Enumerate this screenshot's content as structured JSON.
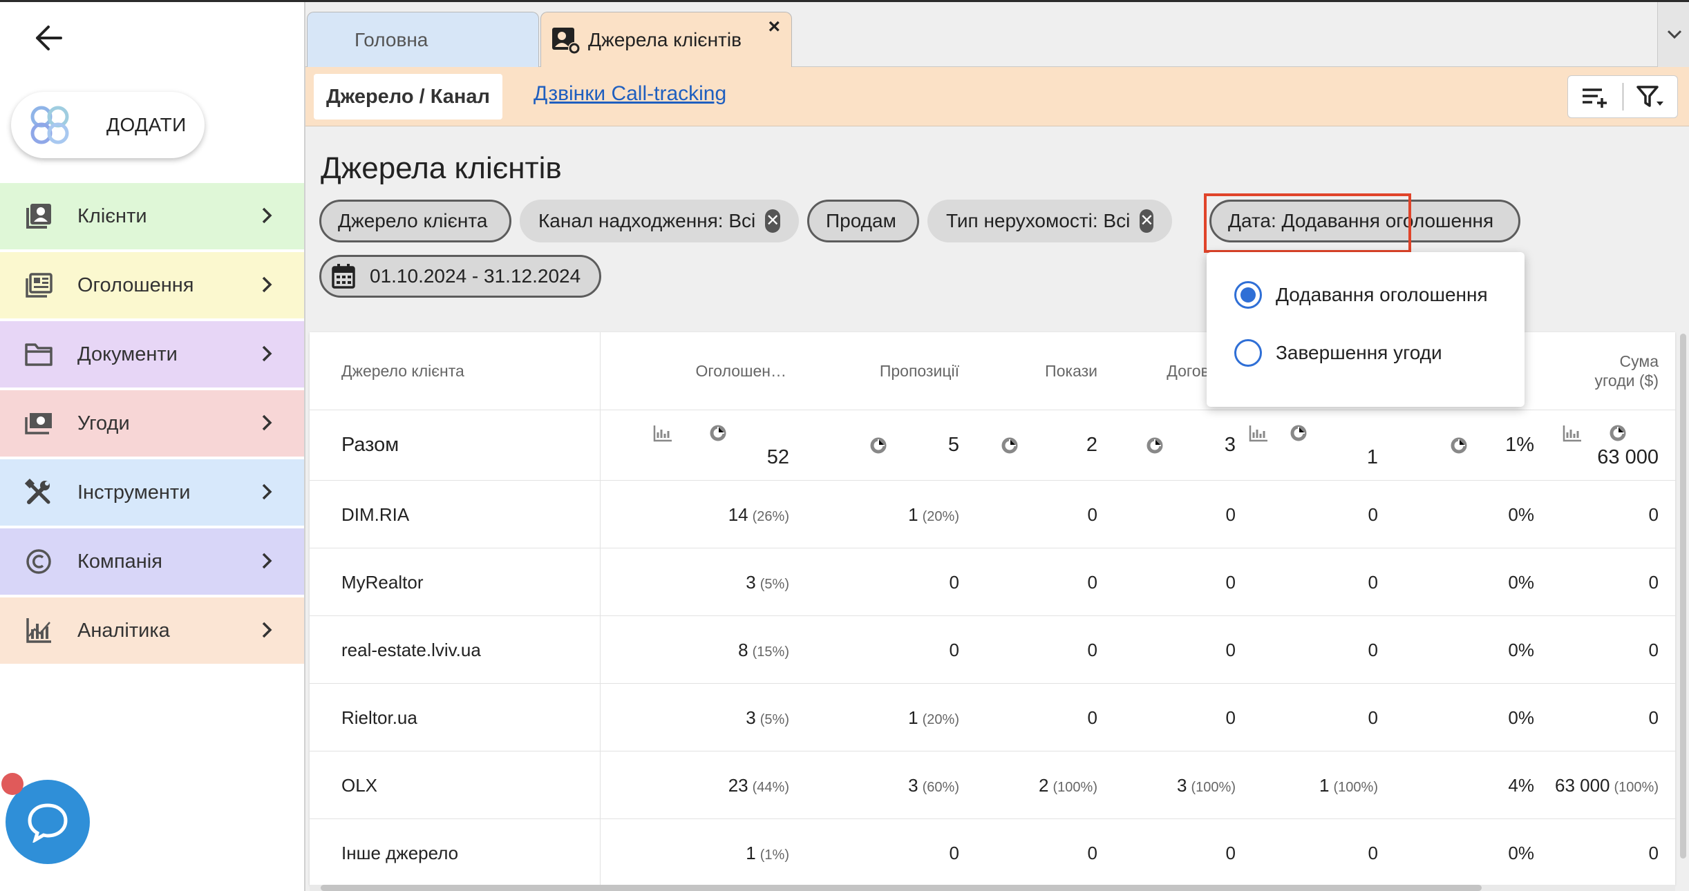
{
  "sidebar": {
    "add_label": "ДОДАТИ",
    "items": [
      {
        "label": "Клієнти",
        "bg": "#dff7d7"
      },
      {
        "label": "Оголошення",
        "bg": "#fbf8cf"
      },
      {
        "label": "Документи",
        "bg": "#e7d6f6"
      },
      {
        "label": "Угоди",
        "bg": "#f7d6d6"
      },
      {
        "label": "Інструменти",
        "bg": "#d7e8fb"
      },
      {
        "label": "Компанія",
        "bg": "#d8d6f8"
      },
      {
        "label": "Аналітика",
        "bg": "#fbe5d4"
      }
    ]
  },
  "tabs": {
    "home": "Головна",
    "sources": "Джерела клієнтів",
    "close": "×"
  },
  "subnav": {
    "active": "Джерело / Канал",
    "link": "Дзвінки Call-tracking"
  },
  "page": {
    "title": "Джерела клієнтів"
  },
  "filters": {
    "source": "Джерело клієнта",
    "channel": "Канал надходження: Всі",
    "deal_type": "Продам",
    "property_type": "Тип нерухомості: Всі",
    "date_type": "Дата: Додавання оголошення",
    "date_range": "01.10.2024 - 31.12.2024",
    "remove": "✕"
  },
  "date_dropdown": {
    "options": [
      {
        "label": "Додавання оголошення",
        "selected": true
      },
      {
        "label": "Завершення угоди",
        "selected": false
      }
    ]
  },
  "table": {
    "headers": [
      "Джерело клієнта",
      "Оголошен…",
      "Пропозиції",
      "Покази",
      "Договори",
      "",
      "",
      "Сума",
      "угоди ($)"
    ],
    "total": {
      "label": "Разом",
      "ads": "52",
      "offers": "5",
      "shows": "2",
      "contracts": "3",
      "deals": "1",
      "conversion": "1%",
      "sum": "63 000"
    },
    "rows": [
      {
        "source": "DIM.RIA",
        "ads": "14",
        "ads_pct": "(26%)",
        "offers": "1",
        "offers_pct": "(20%)",
        "shows": "0",
        "shows_pct": "",
        "contracts": "0",
        "contracts_pct": "",
        "deals": "0",
        "deals_pct": "",
        "conversion": "0%",
        "sum": "0",
        "sum_pct": ""
      },
      {
        "source": "MyRealtor",
        "ads": "3",
        "ads_pct": "(5%)",
        "offers": "0",
        "offers_pct": "",
        "shows": "0",
        "shows_pct": "",
        "contracts": "0",
        "contracts_pct": "",
        "deals": "0",
        "deals_pct": "",
        "conversion": "0%",
        "sum": "0",
        "sum_pct": ""
      },
      {
        "source": "real-estate.lviv.ua",
        "ads": "8",
        "ads_pct": "(15%)",
        "offers": "0",
        "offers_pct": "",
        "shows": "0",
        "shows_pct": "",
        "contracts": "0",
        "contracts_pct": "",
        "deals": "0",
        "deals_pct": "",
        "conversion": "0%",
        "sum": "0",
        "sum_pct": ""
      },
      {
        "source": "Rieltor.ua",
        "ads": "3",
        "ads_pct": "(5%)",
        "offers": "1",
        "offers_pct": "(20%)",
        "shows": "0",
        "shows_pct": "",
        "contracts": "0",
        "contracts_pct": "",
        "deals": "0",
        "deals_pct": "",
        "conversion": "0%",
        "sum": "0",
        "sum_pct": ""
      },
      {
        "source": "OLX",
        "ads": "23",
        "ads_pct": "(44%)",
        "offers": "3",
        "offers_pct": "(60%)",
        "shows": "2",
        "shows_pct": "(100%)",
        "contracts": "3",
        "contracts_pct": "(100%)",
        "deals": "1",
        "deals_pct": "(100%)",
        "conversion": "4%",
        "sum": "63 000",
        "sum_pct": "(100%)"
      },
      {
        "source": "Інше джерело",
        "ads": "1",
        "ads_pct": "(1%)",
        "offers": "0",
        "offers_pct": "",
        "shows": "0",
        "shows_pct": "",
        "contracts": "0",
        "contracts_pct": "",
        "deals": "0",
        "deals_pct": "",
        "conversion": "0%",
        "sum": "0",
        "sum_pct": ""
      }
    ]
  },
  "colors": {
    "accent": "#2f6fd6",
    "highlight": "#e0442a",
    "chat": "#2f8fd8"
  }
}
